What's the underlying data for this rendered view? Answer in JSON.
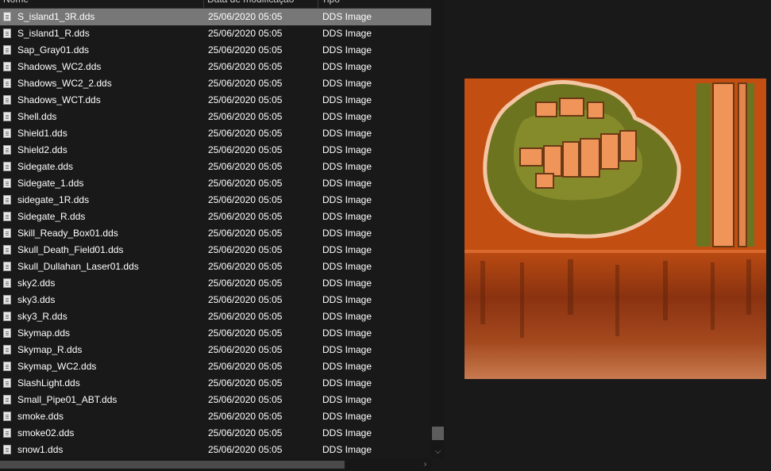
{
  "columns": {
    "name": "Nome",
    "date": "Data de modificação",
    "type": "Tipo"
  },
  "files": [
    {
      "name": "S_island1_3R.dds",
      "date": "25/06/2020 05:05",
      "type": "DDS Image"
    },
    {
      "name": "S_island1_R.dds",
      "date": "25/06/2020 05:05",
      "type": "DDS Image"
    },
    {
      "name": "Sap_Gray01.dds",
      "date": "25/06/2020 05:05",
      "type": "DDS Image"
    },
    {
      "name": "Shadows_WC2.dds",
      "date": "25/06/2020 05:05",
      "type": "DDS Image"
    },
    {
      "name": "Shadows_WC2_2.dds",
      "date": "25/06/2020 05:05",
      "type": "DDS Image"
    },
    {
      "name": "Shadows_WCT.dds",
      "date": "25/06/2020 05:05",
      "type": "DDS Image"
    },
    {
      "name": "Shell.dds",
      "date": "25/06/2020 05:05",
      "type": "DDS Image"
    },
    {
      "name": "Shield1.dds",
      "date": "25/06/2020 05:05",
      "type": "DDS Image"
    },
    {
      "name": "Shield2.dds",
      "date": "25/06/2020 05:05",
      "type": "DDS Image"
    },
    {
      "name": "Sidegate.dds",
      "date": "25/06/2020 05:05",
      "type": "DDS Image"
    },
    {
      "name": "Sidegate_1.dds",
      "date": "25/06/2020 05:05",
      "type": "DDS Image"
    },
    {
      "name": "sidegate_1R.dds",
      "date": "25/06/2020 05:05",
      "type": "DDS Image"
    },
    {
      "name": "Sidegate_R.dds",
      "date": "25/06/2020 05:05",
      "type": "DDS Image"
    },
    {
      "name": "Skill_Ready_Box01.dds",
      "date": "25/06/2020 05:05",
      "type": "DDS Image"
    },
    {
      "name": "Skull_Death_Field01.dds",
      "date": "25/06/2020 05:05",
      "type": "DDS Image"
    },
    {
      "name": "Skull_Dullahan_Laser01.dds",
      "date": "25/06/2020 05:05",
      "type": "DDS Image"
    },
    {
      "name": "sky2.dds",
      "date": "25/06/2020 05:05",
      "type": "DDS Image"
    },
    {
      "name": "sky3.dds",
      "date": "25/06/2020 05:05",
      "type": "DDS Image"
    },
    {
      "name": "sky3_R.dds",
      "date": "25/06/2020 05:05",
      "type": "DDS Image"
    },
    {
      "name": "Skymap.dds",
      "date": "25/06/2020 05:05",
      "type": "DDS Image"
    },
    {
      "name": "Skymap_R.dds",
      "date": "25/06/2020 05:05",
      "type": "DDS Image"
    },
    {
      "name": "Skymap_WC2.dds",
      "date": "25/06/2020 05:05",
      "type": "DDS Image"
    },
    {
      "name": "SlashLight.dds",
      "date": "25/06/2020 05:05",
      "type": "DDS Image"
    },
    {
      "name": "Small_Pipe01_ABT.dds",
      "date": "25/06/2020 05:05",
      "type": "DDS Image"
    },
    {
      "name": "smoke.dds",
      "date": "25/06/2020 05:05",
      "type": "DDS Image"
    },
    {
      "name": "smoke02.dds",
      "date": "25/06/2020 05:05",
      "type": "DDS Image"
    },
    {
      "name": "snow1.dds",
      "date": "25/06/2020 05:05",
      "type": "DDS Image"
    }
  ],
  "selected_index": 0,
  "icons": {
    "file": "file-icon",
    "scroll_down": "chevron-down-icon",
    "scroll_right": "chevron-right-icon"
  },
  "colors": {
    "selection": "#777777",
    "background": "#191919",
    "preview_orange": "#c24e12",
    "preview_green": "#6d7420",
    "preview_tile": "#f0955a"
  }
}
